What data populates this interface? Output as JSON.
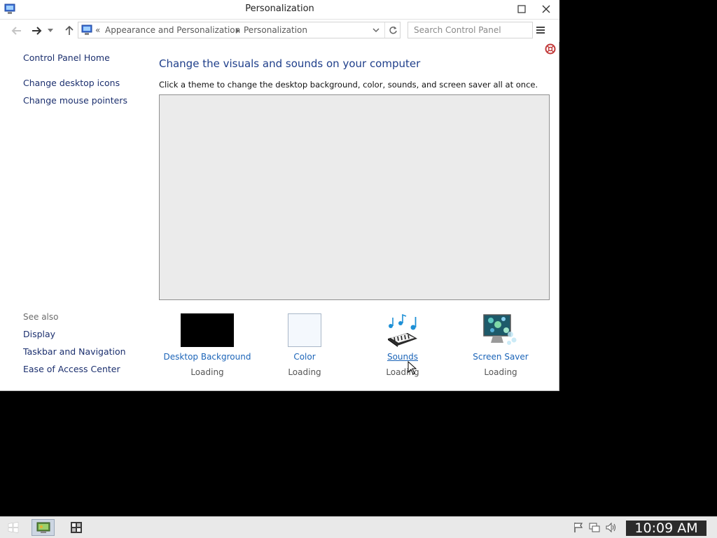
{
  "window": {
    "title": "Personalization"
  },
  "address": {
    "overflow": "«",
    "crumbs": [
      "Appearance and Personalization",
      "Personalization"
    ]
  },
  "search": {
    "placeholder": "Search Control Panel"
  },
  "sidebar": {
    "top_links": [
      "Control Panel Home",
      "Change desktop icons",
      "Change mouse pointers"
    ],
    "see_also_label": "See also",
    "see_also_links": [
      "Display",
      "Taskbar and Navigation",
      "Ease of Access Center"
    ]
  },
  "main": {
    "heading": "Change the visuals and sounds on your computer",
    "description": "Click a theme to change the desktop background, color, sounds, and screen saver all at once."
  },
  "settings": [
    {
      "label": "Desktop Background",
      "status": "Loading"
    },
    {
      "label": "Color",
      "status": "Loading"
    },
    {
      "label": "Sounds",
      "status": "Loading"
    },
    {
      "label": "Screen Saver",
      "status": "Loading"
    }
  ],
  "taskbar": {
    "clock": "10:09 AM"
  },
  "colors": {
    "link": "#1b64b8",
    "heading": "#1e3e8a",
    "nav_link": "#1b2f6e"
  }
}
